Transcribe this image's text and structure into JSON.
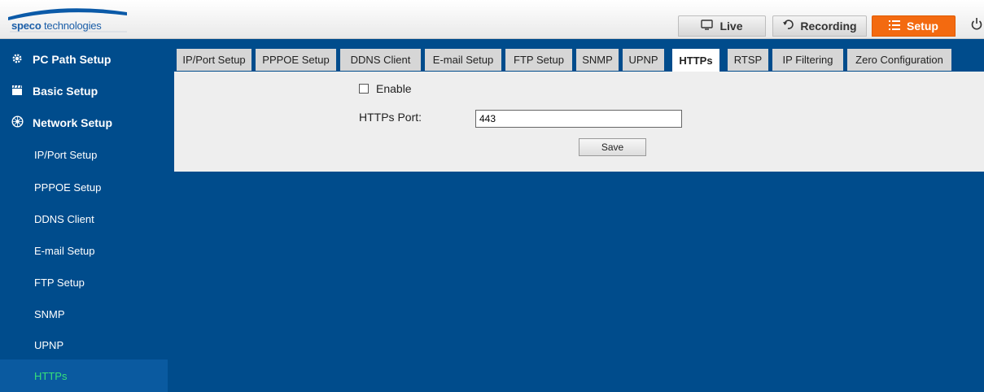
{
  "header": {
    "logo_brand": "speco",
    "logo_suffix": "technologies",
    "live_label": "Live",
    "recording_label": "Recording",
    "setup_label": "Setup",
    "icons": [
      "monitor-icon",
      "undo-arrow-icon",
      "list-icon",
      "power-icon"
    ],
    "accent_color": "#f36a10"
  },
  "sidebar": {
    "sections": [
      {
        "label": "PC Path Setup",
        "icon": "gear-icon"
      },
      {
        "label": "Basic Setup",
        "icon": "clapperboard-icon"
      },
      {
        "label": "Network Setup",
        "icon": "network-icon"
      }
    ],
    "items": [
      {
        "label": "IP/Port Setup"
      },
      {
        "label": "PPPOE Setup"
      },
      {
        "label": "DDNS Client"
      },
      {
        "label": "E-mail Setup"
      },
      {
        "label": "FTP Setup"
      },
      {
        "label": "SNMP"
      },
      {
        "label": "UPNP"
      },
      {
        "label": "HTTPs",
        "active": true
      }
    ],
    "active_color": "#36e07a"
  },
  "tabs": [
    {
      "label": "IP/Port Setup"
    },
    {
      "label": "PPPOE Setup"
    },
    {
      "label": "DDNS Client"
    },
    {
      "label": "E-mail Setup"
    },
    {
      "label": "FTP Setup"
    },
    {
      "label": "SNMP"
    },
    {
      "label": "UPNP"
    },
    {
      "label": "HTTPs",
      "active": true
    },
    {
      "label": "RTSP"
    },
    {
      "label": "IP Filtering"
    },
    {
      "label": "Zero Configuration"
    }
  ],
  "form": {
    "enable_label": "Enable",
    "enable_checked": false,
    "port_label": "HTTPs Port:",
    "port_value": "443",
    "save_label": "Save"
  }
}
